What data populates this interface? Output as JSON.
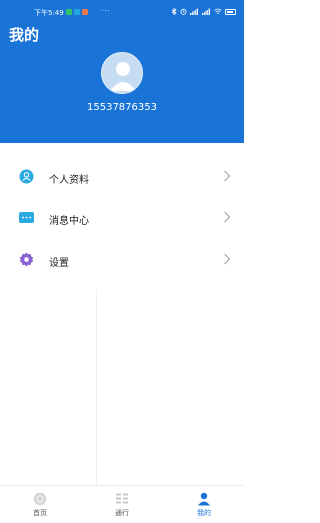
{
  "status_bar": {
    "time": "下午5:49",
    "more": "···",
    "battery": "97"
  },
  "header": {
    "title": "我的",
    "phone": "15537876353"
  },
  "menu": [
    {
      "label": "个人资料",
      "icon": "user-icon"
    },
    {
      "label": "消息中心",
      "icon": "message-icon"
    },
    {
      "label": "设置",
      "icon": "settings-icon"
    }
  ],
  "bottom_nav": [
    {
      "label": "首页",
      "icon": "home-icon",
      "active": false
    },
    {
      "label": "通行",
      "icon": "pass-icon",
      "active": false
    },
    {
      "label": "我的",
      "icon": "profile-icon",
      "active": true
    }
  ],
  "colors": {
    "primary": "#1a74d8",
    "icon_blue": "#2aa9e0",
    "icon_purple": "#8a63d2"
  }
}
